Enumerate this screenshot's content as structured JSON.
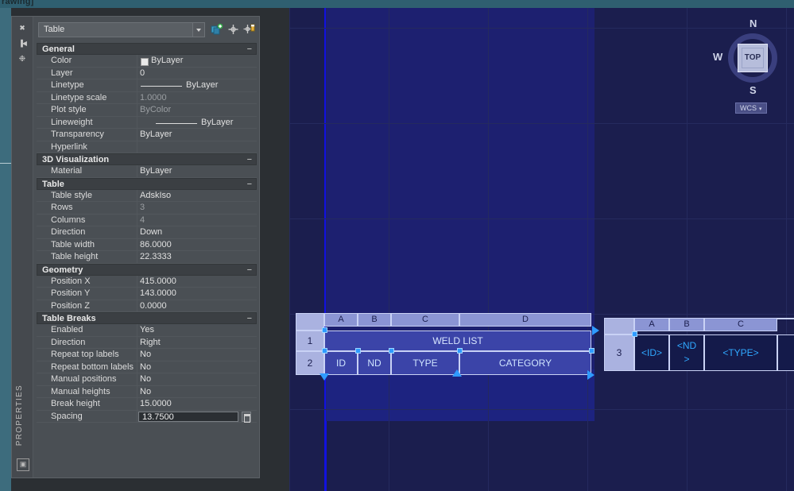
{
  "window": {
    "title_fragment": "rawing]"
  },
  "palette": {
    "vertical_title": "PROPERTIES",
    "icons": {
      "close": "close-icon",
      "autohide": "auto-hide-icon",
      "settings": "settings-icon",
      "bottom": "properties-panel-icon"
    },
    "selector": {
      "value": "Table",
      "dropdown": "chevron-down-icon",
      "toolbar_icons": [
        "quick-select-icon",
        "pick-point-icon",
        "quick-select-alt-icon"
      ]
    },
    "categories": [
      {
        "name": "General",
        "collapse": "−",
        "rows": [
          {
            "name": "Color",
            "value": "ByLayer",
            "kind": "color",
            "dim": false
          },
          {
            "name": "Layer",
            "value": "0",
            "kind": "text",
            "dim": false
          },
          {
            "name": "Linetype",
            "value": "ByLayer",
            "kind": "linetype",
            "dim": false
          },
          {
            "name": "Linetype scale",
            "value": "1.0000",
            "kind": "text",
            "dim": true
          },
          {
            "name": "Plot style",
            "value": "ByColor",
            "kind": "text",
            "dim": true
          },
          {
            "name": "Lineweight",
            "value": "ByLayer",
            "kind": "lineweight",
            "dim": false
          },
          {
            "name": "Transparency",
            "value": "ByLayer",
            "kind": "text",
            "dim": false
          },
          {
            "name": "Hyperlink",
            "value": "",
            "kind": "text",
            "dim": false
          }
        ]
      },
      {
        "name": "3D Visualization",
        "collapse": "−",
        "rows": [
          {
            "name": "Material",
            "value": "ByLayer",
            "kind": "text",
            "dim": false
          }
        ]
      },
      {
        "name": "Table",
        "collapse": "−",
        "rows": [
          {
            "name": "Table style",
            "value": "AdskIso",
            "kind": "text",
            "dim": false
          },
          {
            "name": "Rows",
            "value": "3",
            "kind": "text",
            "dim": true
          },
          {
            "name": "Columns",
            "value": "4",
            "kind": "text",
            "dim": true
          },
          {
            "name": "Direction",
            "value": "Down",
            "kind": "text",
            "dim": false
          },
          {
            "name": "Table width",
            "value": "86.0000",
            "kind": "text",
            "dim": false
          },
          {
            "name": "Table height",
            "value": "22.3333",
            "kind": "text",
            "dim": false
          }
        ]
      },
      {
        "name": "Geometry",
        "collapse": "−",
        "rows": [
          {
            "name": "Position X",
            "value": "415.0000",
            "kind": "text",
            "dim": false
          },
          {
            "name": "Position Y",
            "value": "143.0000",
            "kind": "text",
            "dim": false
          },
          {
            "name": "Position Z",
            "value": "0.0000",
            "kind": "text",
            "dim": false
          }
        ]
      },
      {
        "name": "Table Breaks",
        "collapse": "−",
        "rows": [
          {
            "name": "Enabled",
            "value": "Yes",
            "kind": "text",
            "dim": false
          },
          {
            "name": "Direction",
            "value": "Right",
            "kind": "text",
            "dim": false
          },
          {
            "name": "Repeat top labels",
            "value": "No",
            "kind": "text",
            "dim": false
          },
          {
            "name": "Repeat bottom labels",
            "value": "No",
            "kind": "text",
            "dim": false
          },
          {
            "name": "Manual positions",
            "value": "No",
            "kind": "text",
            "dim": false
          },
          {
            "name": "Manual heights",
            "value": "No",
            "kind": "text",
            "dim": false
          },
          {
            "name": "Break height",
            "value": "15.0000",
            "kind": "text",
            "dim": false
          },
          {
            "name": "Spacing",
            "value": "13.7500",
            "kind": "active",
            "dim": false
          }
        ]
      }
    ]
  },
  "canvas": {
    "table_main": {
      "column_headers": [
        "A",
        "B",
        "C",
        "D"
      ],
      "row_headers": [
        "1",
        "2"
      ],
      "title_row": "WELD  LIST",
      "label_row": [
        "ID",
        "ND",
        "TYPE",
        "CATEGORY"
      ]
    },
    "table_break": {
      "column_headers": [
        "A",
        "B",
        "C"
      ],
      "row_headers": [
        "3"
      ],
      "cells": [
        "<ID>",
        "<ND\n>",
        "<TYPE>"
      ]
    },
    "viewcube": {
      "face": "TOP",
      "north": "N",
      "south": "S",
      "west": "W",
      "ucs": "WCS",
      "ucs_arrow": "▾"
    }
  },
  "colors": {
    "canvas_bg": "#1b1e4e",
    "selection_blue": "#1111e0",
    "grip_cyan": "#2f9bff",
    "palette_bg": "#4a4f54",
    "app_teal": "#3d6c7d"
  }
}
